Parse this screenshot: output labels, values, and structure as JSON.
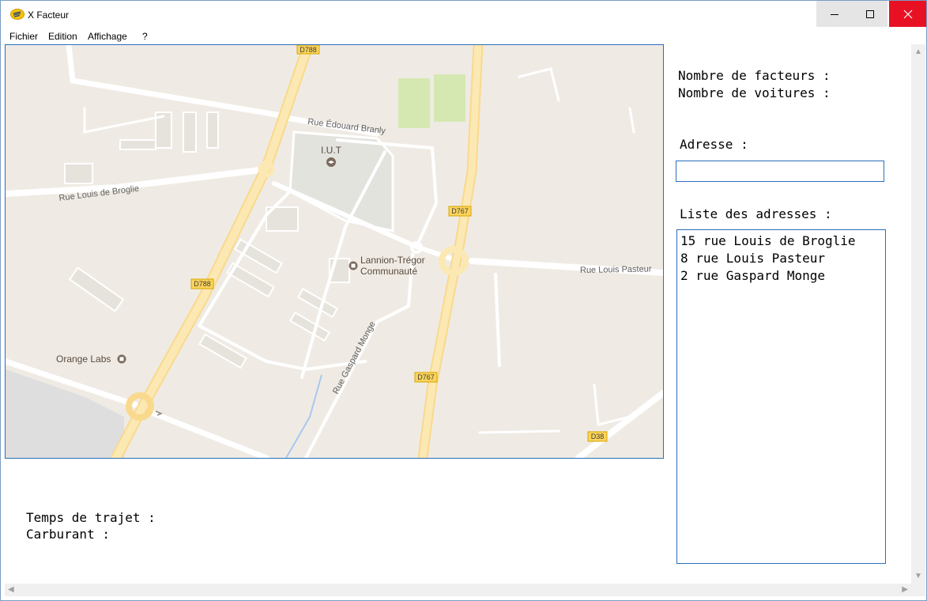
{
  "window": {
    "title": "X Facteur"
  },
  "menu": [
    "Fichier",
    "Edition",
    "Affichage",
    "?"
  ],
  "map": {
    "roads": {
      "rue_edouard_branly": "Rue Édouard Branly",
      "rue_louis_de_broglie": "Rue Louis de Broglie",
      "rue_louis_pasteur": "Rue Louis Pasteur",
      "rue_gaspard_monge": "Rue Gaspard Monge"
    },
    "road_shields": {
      "d788": "D788",
      "d767": "D767",
      "d38": "D38"
    },
    "places": {
      "iut": "I.U.T",
      "lannion_line1": "Lannion-Trégor",
      "lannion_line2": "Communauté",
      "orange_labs": "Orange Labs"
    }
  },
  "stats": {
    "nombre_facteurs_label": "Nombre de facteurs :",
    "nombre_voitures_label": "Nombre de voitures :"
  },
  "adresse": {
    "label": "Adresse :",
    "value": ""
  },
  "liste": {
    "label": "Liste des adresses :",
    "items": [
      "15 rue Louis de Broglie",
      "8 rue Louis Pasteur",
      "2 rue Gaspard Monge"
    ]
  },
  "trajet": {
    "temps_label": "Temps de trajet :",
    "carburant_label": "Carburant :"
  }
}
